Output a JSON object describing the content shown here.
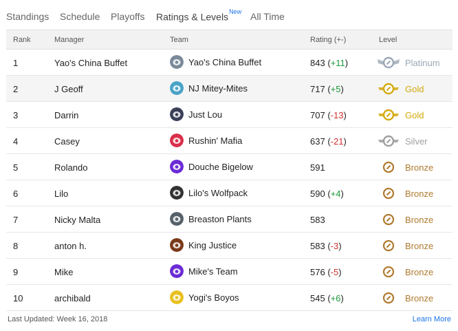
{
  "tabs": [
    {
      "label": "Standings",
      "active": false
    },
    {
      "label": "Schedule",
      "active": false
    },
    {
      "label": "Playoffs",
      "active": false
    },
    {
      "label": "Ratings & Levels",
      "badge": "New",
      "active": true
    },
    {
      "label": "All Time",
      "active": false
    }
  ],
  "table": {
    "headers": {
      "rank": "Rank",
      "manager": "Manager",
      "team": "Team",
      "rating": "Rating (+-)",
      "level": "Level"
    },
    "rows": [
      {
        "rank": "1",
        "manager": "Yao's China Buffet",
        "team": "Yao's China Buffet",
        "rating": "843",
        "change": "+11",
        "level": "Platinum",
        "logo_color": "#7a8a9a",
        "icon": "platinum-icon"
      },
      {
        "rank": "2",
        "manager": "J Geoff",
        "team": "NJ Mitey-Mites",
        "rating": "717",
        "change": "+5",
        "level": "Gold",
        "logo_color": "#4aa3c7",
        "icon": "gold-icon"
      },
      {
        "rank": "3",
        "manager": "Darrin",
        "team": "Just Lou",
        "rating": "707",
        "change": "-13",
        "level": "Gold",
        "logo_color": "#3a3f57",
        "icon": "gold-icon"
      },
      {
        "rank": "4",
        "manager": "Casey",
        "team": "Rushin' Mafia",
        "rating": "637",
        "change": "-21",
        "level": "Silver",
        "logo_color": "#d9304a",
        "icon": "silver-icon"
      },
      {
        "rank": "5",
        "manager": "Rolando",
        "team": "Douche Bigelow",
        "rating": "591",
        "change": "",
        "level": "Bronze",
        "logo_color": "#6a2bd6",
        "icon": "bronze-icon"
      },
      {
        "rank": "6",
        "manager": "Lilo",
        "team": "Lilo's Wolfpack",
        "rating": "590",
        "change": "+4",
        "level": "Bronze",
        "logo_color": "#333333",
        "icon": "bronze-icon"
      },
      {
        "rank": "7",
        "manager": "Nicky Malta",
        "team": "Breaston Plants",
        "rating": "583",
        "change": "",
        "level": "Bronze",
        "logo_color": "#55606a",
        "icon": "bronze-icon"
      },
      {
        "rank": "8",
        "manager": "anton h.",
        "team": "King Justice",
        "rating": "583",
        "change": "-3",
        "level": "Bronze",
        "logo_color": "#7a3a1a",
        "icon": "bronze-icon"
      },
      {
        "rank": "9",
        "manager": "Mike",
        "team": "Mike's Team",
        "rating": "576",
        "change": "-5",
        "level": "Bronze",
        "logo_color": "#6a2bd6",
        "icon": "bronze-icon"
      },
      {
        "rank": "10",
        "manager": "archibald",
        "team": "Yogi's Boyos",
        "rating": "545",
        "change": "+6",
        "level": "Bronze",
        "logo_color": "#e8c020",
        "icon": "bronze-icon"
      }
    ]
  },
  "level_colors": {
    "Platinum": "#9aa7b4",
    "Gold": "#d4a90c",
    "Silver": "#9e9e9e",
    "Bronze": "#b07a2e"
  },
  "footer": {
    "updated": "Last Updated: Week 16, 2018",
    "learn_more": "Learn More"
  }
}
